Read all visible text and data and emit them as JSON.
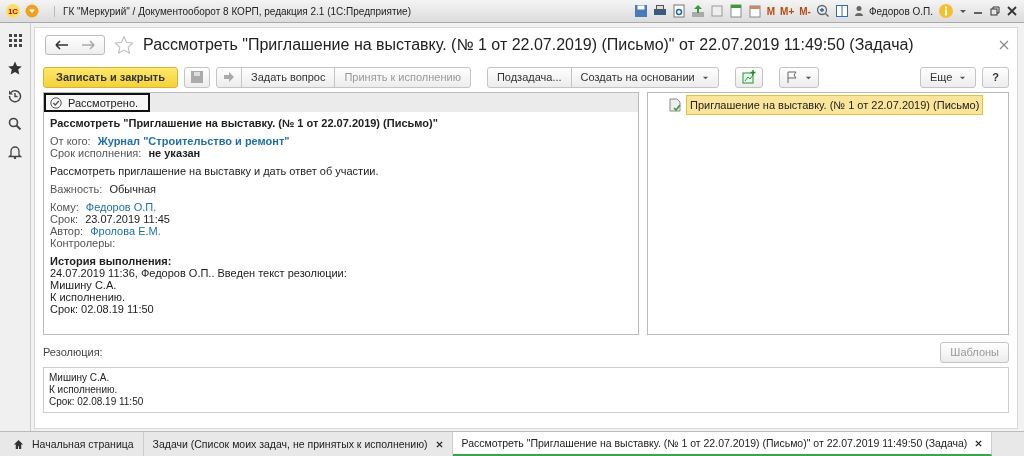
{
  "app_bar": {
    "logo": "1С",
    "title": "ГК \"Меркурий\" / Документооборот 8 КОРП, редакция 2.1  (1С:Предприятие)",
    "memory_buttons": [
      "M",
      "M+",
      "M-"
    ],
    "user": "Федоров О.П."
  },
  "form": {
    "title": "Рассмотреть \"Приглашение на выставку. (№ 1 от 22.07.2019) (Письмо)\" от 22.07.2019 11:49:50 (Задача)",
    "favorite": false
  },
  "toolbar": {
    "primary": "Записать и закрыть",
    "buttons": [
      {
        "label": "Задать вопрос",
        "disabled": false
      },
      {
        "label": "Принять к исполнению",
        "disabled": true
      }
    ],
    "menus": [
      "Подзадача...",
      "Создать на основании"
    ],
    "more": "Еще",
    "help": "?"
  },
  "status": {
    "label": "Рассмотрено.",
    "checked": true
  },
  "task": {
    "heading": "Рассмотреть \"Приглашение на выставку. (№ 1 от 22.07.2019) (Письмо)\"",
    "field_groups": [
      [
        {
          "label": "От кого:",
          "value": "Журнал \"Строительство и ремонт\"",
          "kind": "link_bold"
        },
        {
          "label": "Срок исполнения:",
          "value": "не указан",
          "kind": "bold"
        }
      ],
      [
        {
          "value": "Рассмотреть приглашение на выставку и дать ответ об участии.",
          "kind": "text"
        }
      ],
      [
        {
          "label": "Важность:",
          "value": "Обычная",
          "kind": "text"
        }
      ],
      [
        {
          "label": "Кому:",
          "value": "Федоров О.П.",
          "kind": "link"
        },
        {
          "label": "Срок:",
          "value": "23.07.2019 11:45",
          "kind": "text"
        },
        {
          "label": "Автор:",
          "value": "Фролова Е.М.",
          "kind": "link"
        },
        {
          "label": "Контролеры:"
        }
      ]
    ],
    "history_title": "История выполнения:",
    "history": [
      "24.07.2019 11:36, Федоров О.П.. Введен текст резолюции:",
      "Мишину С.А.",
      "К исполнению.",
      "Срок: 02.08.19 11:50"
    ]
  },
  "related": {
    "label": "Приглашение на выставку. (№ 1 от 22.07.2019) (Письмо)",
    "selected": true
  },
  "resolution": {
    "label": "Резолюция:",
    "templates_button": "Шаблоны",
    "templates_disabled": true,
    "lines": [
      "Мишину С.А.",
      "К исполнению.",
      "Срок: 02.08.19 11:50"
    ]
  },
  "tabs": [
    {
      "label": "Начальная страница",
      "kind": "home",
      "selected": false
    },
    {
      "label": "Задачи (Список моих задач, не принятых к исполнению)",
      "kind": "page",
      "selected": false
    },
    {
      "label": "Рассмотреть \"Приглашение на выставку. (№ 1 от 22.07.2019) (Письмо)\" от 22.07.2019 11:49:50 (Задача)",
      "kind": "page",
      "selected": true
    }
  ]
}
